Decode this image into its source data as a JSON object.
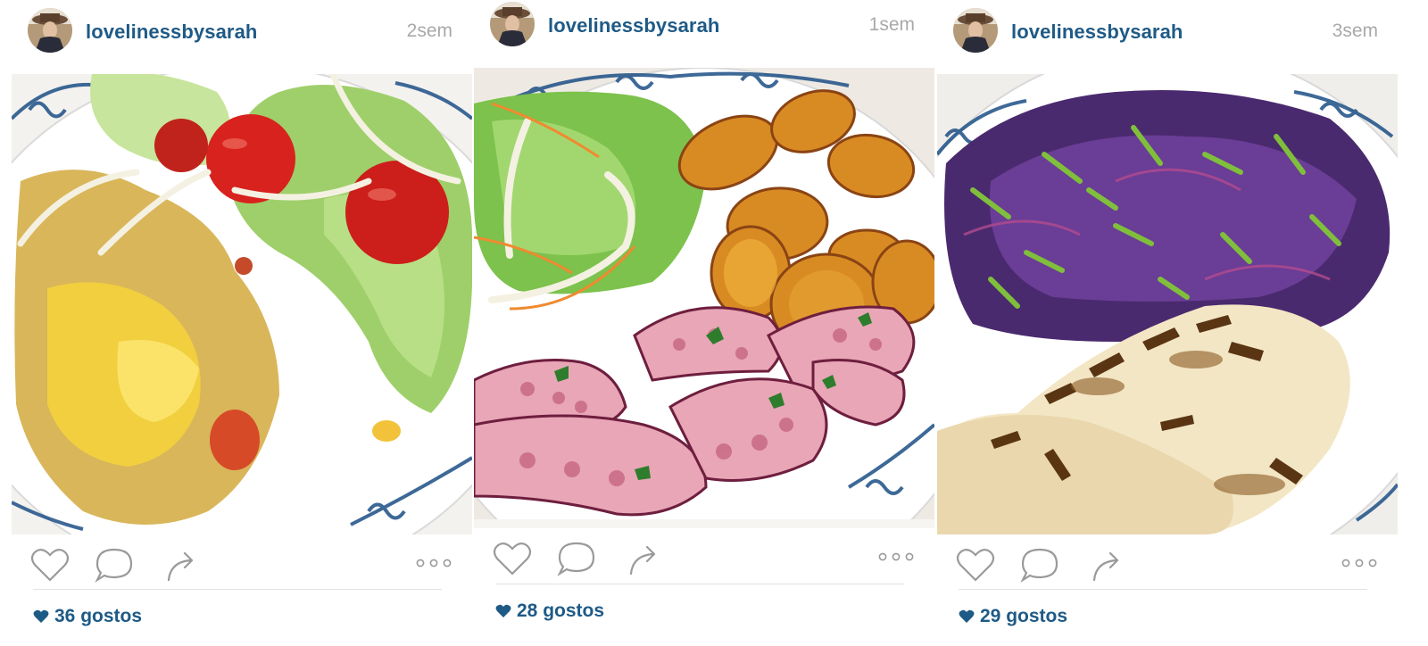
{
  "colors": {
    "link": "#1e5a86",
    "timestamp": "#a9a9a9",
    "divider": "#e3e3e3",
    "icon_stroke": "#9a9a9a",
    "plate_pattern": "#1c4f86"
  },
  "posts": [
    {
      "username": "lovelinessbysarah",
      "time": "2sem",
      "likes": "36 gostos",
      "image": "scrambled-eggs-with-tuna-and-salad",
      "icons": [
        "heart-icon",
        "comment-icon",
        "share-icon",
        "more-icon"
      ]
    },
    {
      "username": "lovelinessbysarah",
      "time": "1sem",
      "likes": "28 gostos",
      "image": "octopus-with-sweet-potato-and-salad",
      "icons": [
        "heart-icon",
        "comment-icon",
        "share-icon",
        "more-icon"
      ]
    },
    {
      "username": "lovelinessbysarah",
      "time": "3sem",
      "likes": "29 gostos",
      "image": "grilled-chicken-with-red-cabbage",
      "icons": [
        "heart-icon",
        "comment-icon",
        "share-icon",
        "more-icon"
      ]
    }
  ]
}
